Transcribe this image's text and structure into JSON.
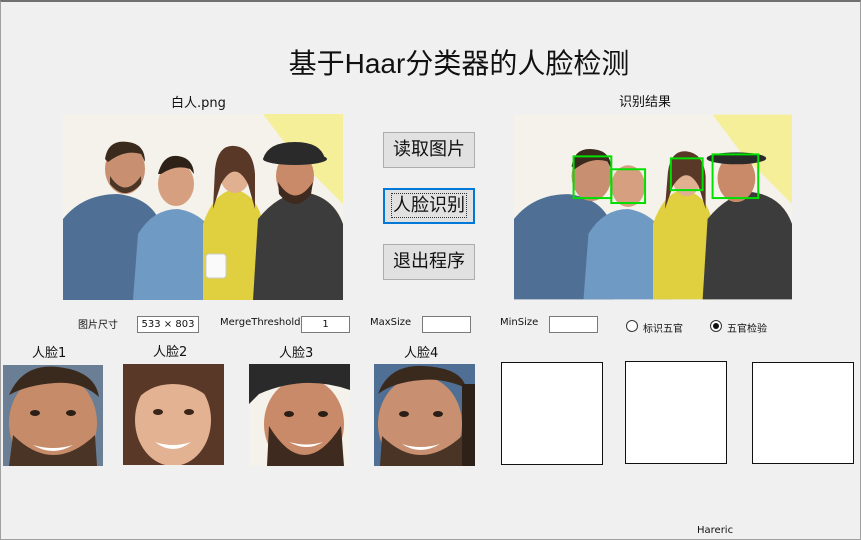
{
  "title": "基于Haar分类器的人脸检测",
  "source_label": "白人.png",
  "result_label": "识别结果",
  "buttons": {
    "read": "读取图片",
    "detect": "人脸识别",
    "exit": "退出程序"
  },
  "params": {
    "size_label": "图片尺寸",
    "size_value": "533 × 803",
    "merge_label": "MergeThreshold",
    "merge_value": "1",
    "max_label": "MaxSize",
    "max_value": "",
    "min_label": "MinSize",
    "min_value": ""
  },
  "radios": [
    {
      "label": "标识五官",
      "selected": false
    },
    {
      "label": "五官检验",
      "selected": true
    }
  ],
  "faces": [
    "人脸1",
    "人脸2",
    "人脸3",
    "人脸4"
  ],
  "author": "Hareric",
  "colors": {
    "detect_box": "#00e000",
    "focus": "#0078d7"
  }
}
